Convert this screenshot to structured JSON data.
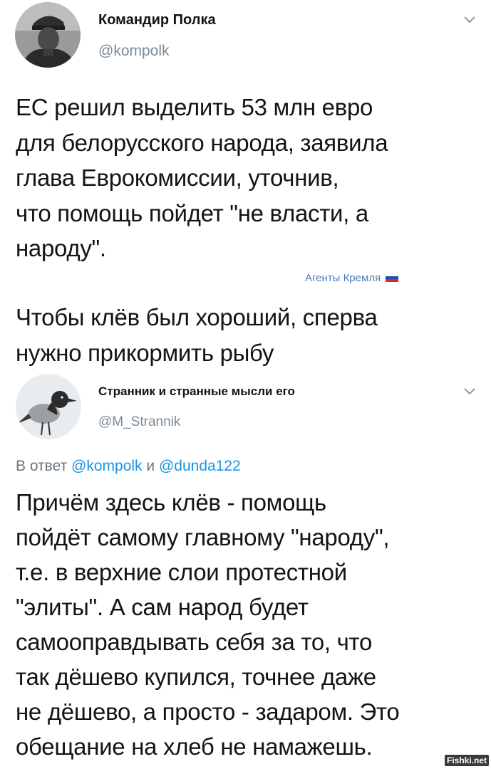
{
  "tweet1": {
    "display_name": "Командир Полка",
    "handle": "@kompolk",
    "text": "ЕС решил выделить 53 млн евро\nдля белорусского народа, заявила\nглава Еврокомиссии, уточнив,\nчто помощь пойдет  \"не власти, а\nнароду\".",
    "caption": "Агенты Кремля"
  },
  "comment": {
    "text": "Чтобы клёв был хороший, сперва\nнужно прикормить рыбу"
  },
  "tweet2": {
    "display_name": "Странник и странные мысли его",
    "handle": "@M_Strannik",
    "reply_prefix": "В ответ",
    "reply_mention_1": "@kompolk",
    "reply_join": "и",
    "reply_mention_2": "@dunda122",
    "text": "Причём здесь клёв - помощь\nпойдёт самому главному \"народу\",\nт.е. в верхние слои протестной\n\"элиты\". А сам народ будет\nсамооправдывать себя за то, что\nтак дёшево купился, точнее даже\nне дёшево, а просто - задаром. Это\nобещание на хлеб не намажешь."
  },
  "watermark": "Fishki.net",
  "colors": {
    "handle": "#7b8b97",
    "mention": "#1b95e0",
    "caption": "#4c7cb8",
    "text": "#141414"
  }
}
